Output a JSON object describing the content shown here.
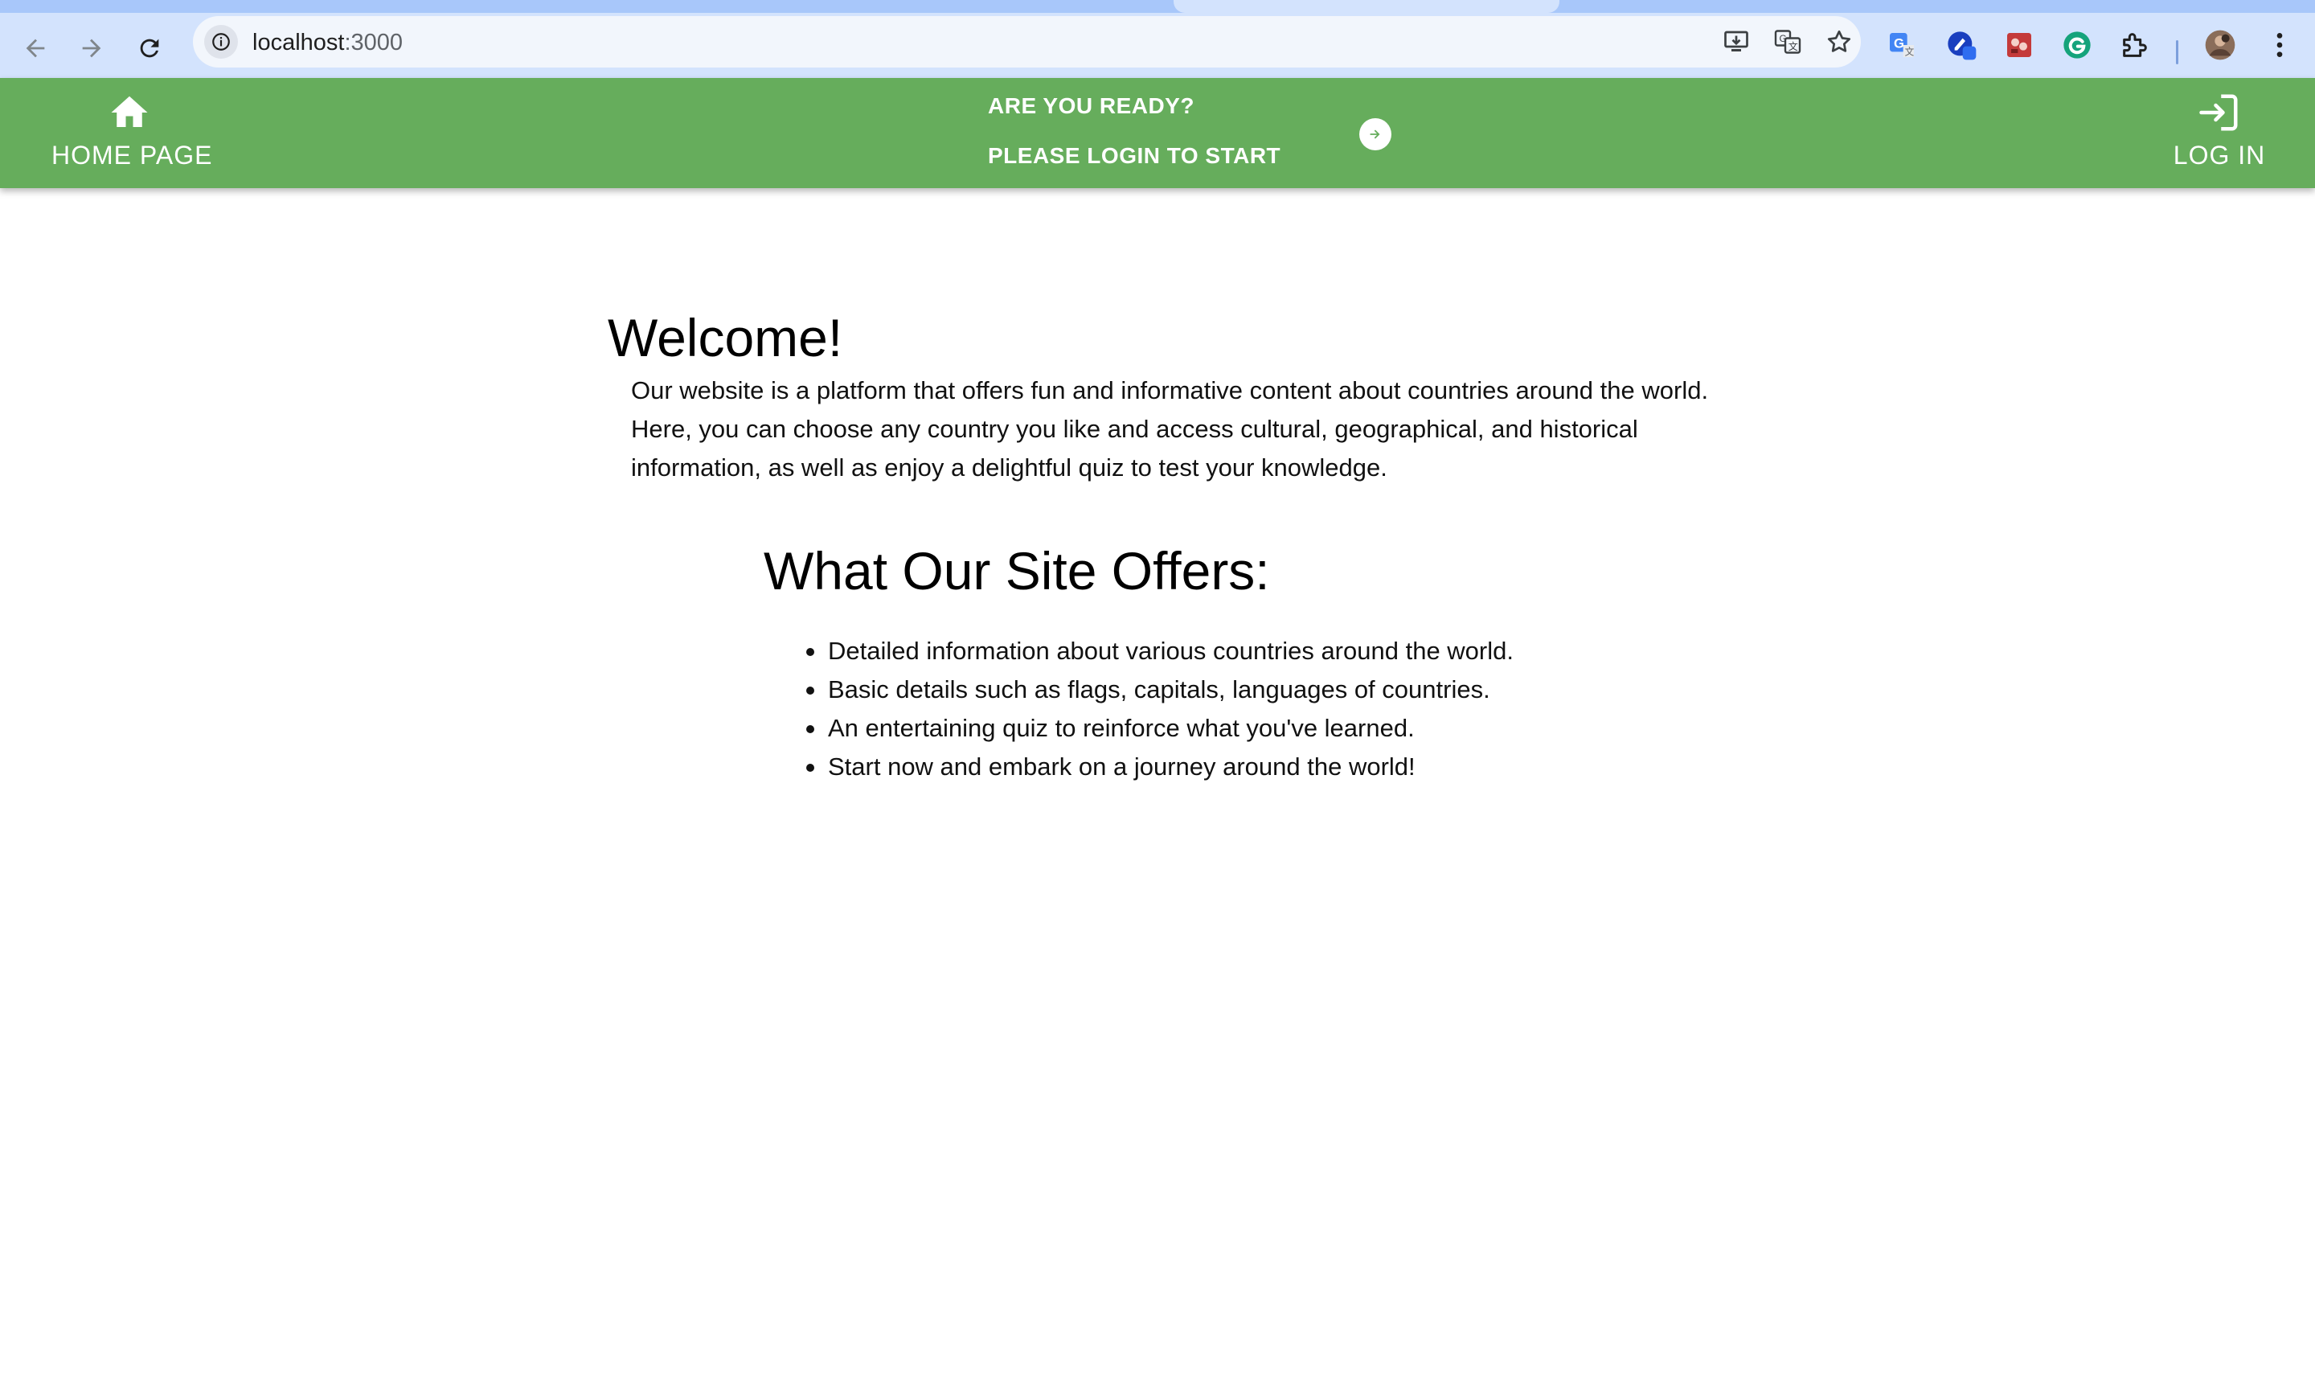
{
  "browser": {
    "url_host": "localhost",
    "url_port": ":3000",
    "nav": {
      "back_icon": "arrow-left-icon",
      "forward_icon": "arrow-right-icon",
      "reload_icon": "reload-icon"
    },
    "omnibox_icons": [
      "install-app-icon",
      "translate-icon",
      "bookmark-star-icon"
    ],
    "extensions": [
      "google-translate-extension-icon",
      "pen-extension-icon",
      "red-extension-icon",
      "grammarly-icon",
      "puzzle-extensions-icon"
    ],
    "profile_icon": "profile-avatar",
    "menu_icon": "kebab-menu-icon"
  },
  "header": {
    "accent_color": "#66ad5c",
    "home_label": "HOME PAGE",
    "home_icon": "home-icon",
    "promo_line1": "ARE YOU READY?",
    "promo_line2": "PLEASE LOGIN TO START",
    "promo_icon": "arrow-circle-right-icon",
    "login_label": "LOG IN",
    "login_icon": "login-icon"
  },
  "main": {
    "welcome_title": "Welcome!",
    "intro": "Our website is a platform that offers fun and informative content about countries around the world. Here, you can choose any country you like and access cultural, geographical, and historical information, as well as enjoy a delightful quiz to test your knowledge.",
    "offers_title": "What Our Site Offers:",
    "offers": [
      "Detailed information about various countries around the world.",
      "Basic details such as flags, capitals, languages of countries.",
      "An entertaining quiz to reinforce what you've learned.",
      "Start now and embark on a journey around the world!"
    ]
  }
}
